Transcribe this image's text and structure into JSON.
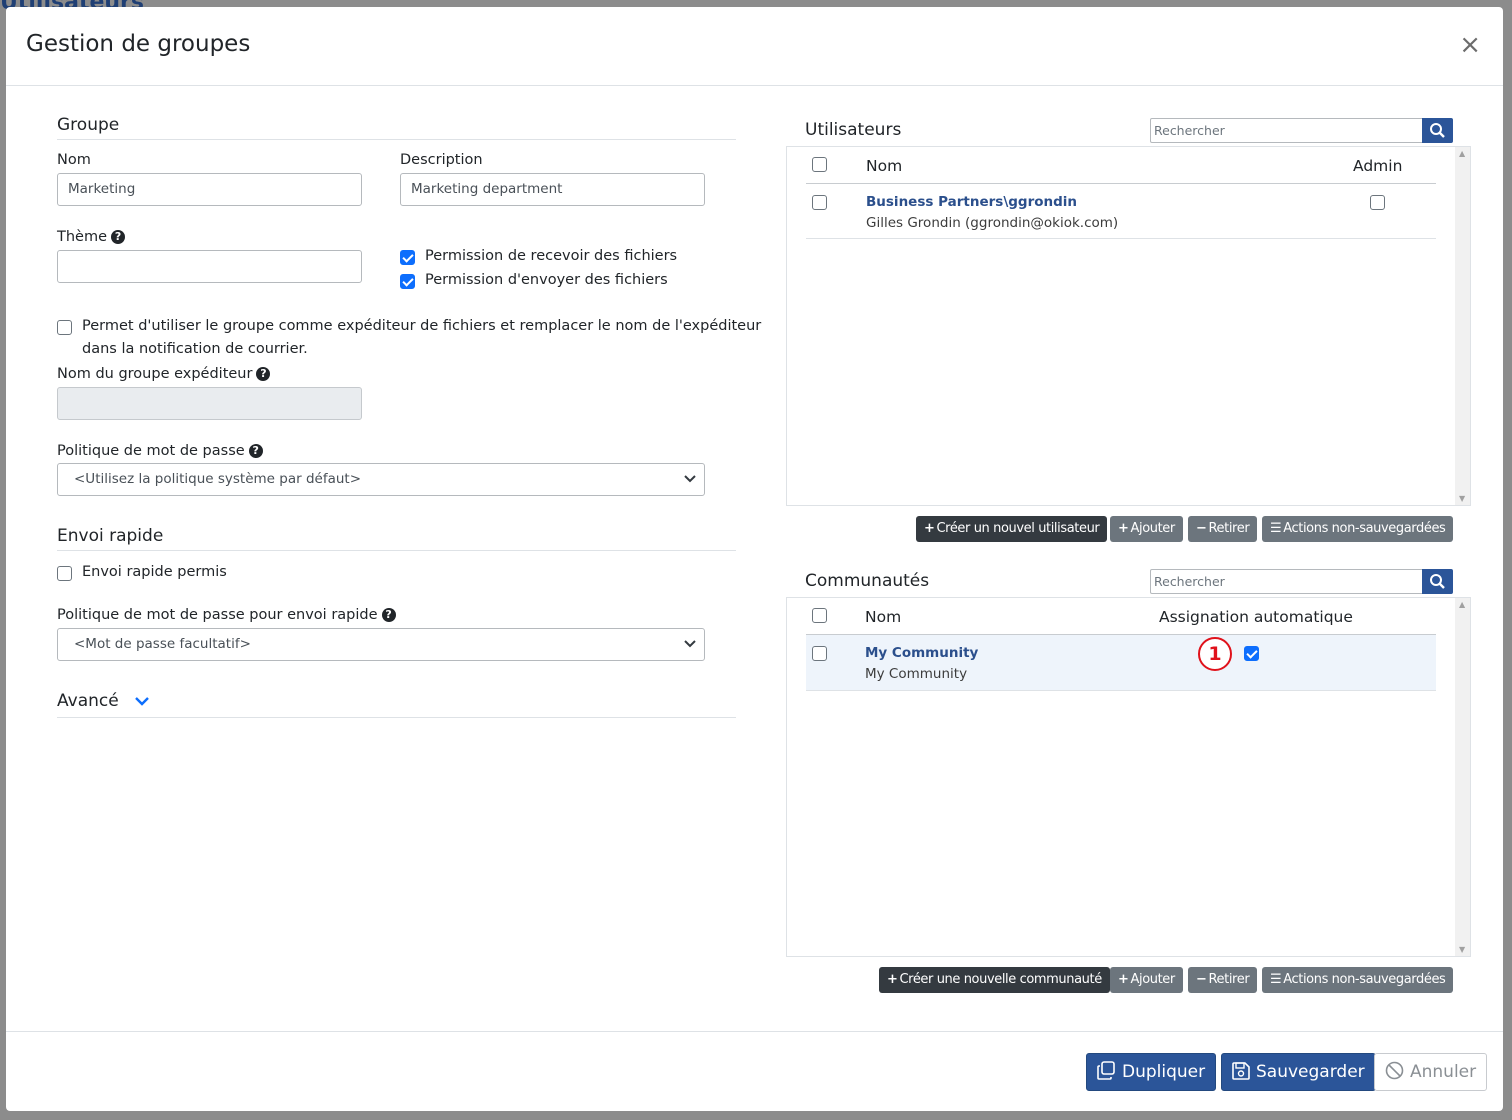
{
  "background": {
    "title": "Utilisateurs"
  },
  "modal": {
    "title": "Gestion de groupes",
    "close": "×"
  },
  "group": {
    "section_title": "Groupe",
    "name_label": "Nom",
    "name_value": "Marketing",
    "description_label": "Description",
    "description_value": "Marketing department",
    "theme_label": "Thème",
    "theme_value": "",
    "perm_receive": {
      "label": "Permission de recevoir des fichiers",
      "checked": true
    },
    "perm_send": {
      "label": "Permission d'envoyer des fichiers",
      "checked": true
    },
    "sender_option": {
      "label_line1": "Permet d'utiliser le groupe comme expéditeur de fichiers et remplacer le nom de l'expéditeur",
      "label_line2": "dans la notification de courrier.",
      "checked": false
    },
    "sender_name_label": "Nom du groupe expéditeur",
    "sender_name_value": "",
    "password_policy_label": "Politique de mot de passe",
    "password_policy_value": "<Utilisez la politique système par défaut>"
  },
  "quick_send": {
    "section_title": "Envoi rapide",
    "allowed": {
      "label": "Envoi rapide permis",
      "checked": false
    },
    "password_policy_label": "Politique de mot de passe pour envoi rapide",
    "password_policy_value": "<Mot de passe facultatif>"
  },
  "advanced": {
    "section_title": "Avancé"
  },
  "users": {
    "title": "Utilisateurs",
    "search_placeholder": "Rechercher",
    "col_name": "Nom",
    "col_admin": "Admin",
    "rows": [
      {
        "name": "Business Partners\\ggrondin",
        "detail": "Gilles Grondin (ggrondin@okiok.com)",
        "admin": false
      }
    ],
    "buttons": {
      "create": "Créer un nouvel utilisateur",
      "add": "Ajouter",
      "remove": "Retirer",
      "unsaved": "Actions non-sauvegardées"
    }
  },
  "communities": {
    "title": "Communautés",
    "search_placeholder": "Rechercher",
    "col_name": "Nom",
    "col_auto": "Assignation automatique",
    "rows": [
      {
        "name": "My Community",
        "detail": "My Community",
        "auto_assign": true
      }
    ],
    "marker": "1",
    "buttons": {
      "create": "Créer une nouvelle communauté",
      "add": "Ajouter",
      "remove": "Retirer",
      "unsaved": "Actions non-sauvegardées"
    }
  },
  "footer": {
    "duplicate": "Dupliquer",
    "save": "Sauvegarder",
    "cancel": "Annuler"
  },
  "colors": {
    "primary": "#2b5599",
    "link": "#2b4f8c",
    "checkbox_checked": "#0d6efd",
    "marker": "#e0121b"
  }
}
